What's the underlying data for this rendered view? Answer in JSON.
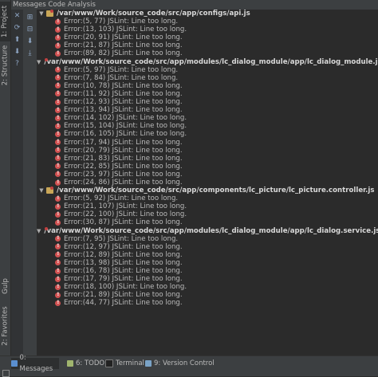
{
  "window": {
    "title": "Messages Code Analysis"
  },
  "left_tabs": [
    {
      "label": "1: Project"
    },
    {
      "label": "2: Structure"
    },
    {
      "label": "Gulp"
    },
    {
      "label": "2: Favorites"
    }
  ],
  "toolbar": {
    "tools": [
      {
        "icon": "expand-all-icon",
        "glyph": "⊞"
      },
      {
        "icon": "collapse-all-icon",
        "glyph": "⊟"
      },
      {
        "icon": "next-icon",
        "glyph": "⬇"
      },
      {
        "icon": "export-icon",
        "glyph": "⤓"
      }
    ]
  },
  "gutter": {
    "tools": [
      {
        "icon": "close-icon",
        "glyph": "✕"
      },
      {
        "icon": "rerun-icon",
        "glyph": "⟳"
      },
      {
        "icon": "up-icon",
        "glyph": "⬆"
      },
      {
        "icon": "down-icon",
        "glyph": "⬇"
      },
      {
        "icon": "help-icon",
        "glyph": "?"
      }
    ]
  },
  "files": [
    {
      "path": "/var/www/Work/source_code/src/app/configs/api.js",
      "errors": [
        "Error:(5, 77)  JSLint: Line too long.",
        "Error:(13, 103)  JSLint: Line too long.",
        "Error:(20, 91)  JSLint: Line too long.",
        "Error:(21, 87)  JSLint: Line too long.",
        "Error:(89, 82)  JSLint: Line too long."
      ]
    },
    {
      "path": "/var/www/Work/source_code/src/app/modules/lc_dialog_module/app/lc_dialog_module.js",
      "errors": [
        "Error:(5, 97)  JSLint: Line too long.",
        "Error:(7, 84)  JSLint: Line too long.",
        "Error:(10, 78)  JSLint: Line too long.",
        "Error:(11, 92)  JSLint: Line too long.",
        "Error:(12, 93)  JSLint: Line too long.",
        "Error:(13, 94)  JSLint: Line too long.",
        "Error:(14, 102)  JSLint: Line too long.",
        "Error:(15, 104)  JSLint: Line too long.",
        "Error:(16, 105)  JSLint: Line too long.",
        "Error:(17, 94)  JSLint: Line too long.",
        "Error:(20, 79)  JSLint: Line too long.",
        "Error:(21, 83)  JSLint: Line too long.",
        "Error:(22, 85)  JSLint: Line too long.",
        "Error:(23, 97)  JSLint: Line too long.",
        "Error:(24, 86)  JSLint: Line too long."
      ]
    },
    {
      "path": "/var/www/Work/source_code/src/app/components/lc_picture/lc_picture.controller.js",
      "errors": [
        "Error:(5, 92)  JSLint: Line too long.",
        "Error:(21, 107)  JSLint: Line too long.",
        "Error:(22, 100)  JSLint: Line too long.",
        "Error:(30, 87)  JSLint: Line too long."
      ]
    },
    {
      "path": "/var/www/Work/source_code/src/app/modules/lc_dialog_module/app/lc_dialog.service.js",
      "errors": [
        "Error:(7, 95)  JSLint: Line too long.",
        "Error:(12, 97)  JSLint: Line too long.",
        "Error:(12, 89)  JSLint: Line too long.",
        "Error:(13, 98)  JSLint: Line too long.",
        "Error:(16, 78)  JSLint: Line too long.",
        "Error:(17, 79)  JSLint: Line too long.",
        "Error:(18, 100)  JSLint: Line too long.",
        "Error:(21, 89)  JSLint: Line too long.",
        "Error:(44, 77)  JSLint: Line too long."
      ]
    }
  ],
  "bottom_tabs": [
    {
      "label": "0: Messages",
      "icon": "messages-icon",
      "color": "#5a8fd0"
    },
    {
      "label": "6: TODO",
      "icon": "todo-icon",
      "color": "#a0b56e"
    },
    {
      "label": "Terminal",
      "icon": "terminal-icon",
      "color": "#222222"
    },
    {
      "label": "9: Version Control",
      "icon": "vcs-icon",
      "color": "#7aa3c7"
    }
  ]
}
